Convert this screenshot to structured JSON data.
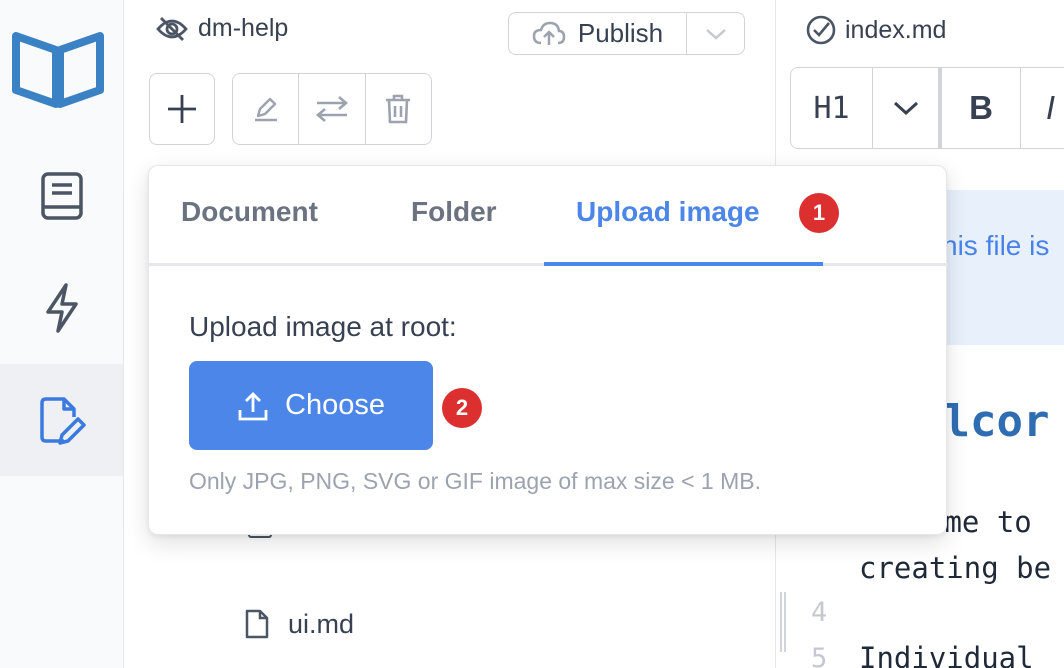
{
  "sidebar": {
    "items": [
      {
        "icon": "book-icon"
      },
      {
        "icon": "lightning-icon"
      },
      {
        "icon": "edit-file-icon",
        "active": true
      }
    ]
  },
  "files": {
    "repo_name": "dm-help",
    "publish_label": "Publish",
    "file_items": [
      "ui.md"
    ]
  },
  "popover": {
    "tabs": [
      "Document",
      "Folder",
      "Upload image"
    ],
    "active_tab": "Upload image",
    "badge_1": "1",
    "badge_2": "2",
    "upload_label": "Upload image at root:",
    "choose_label": "Choose",
    "hint": "Only JPG, PNG, SVG or GIF image of max size < 1 MB."
  },
  "editor": {
    "file_name": "index.md",
    "heading_select": "H1",
    "bold_label": "B",
    "italic_label": "I",
    "notice_text": "his file is",
    "heading_text": "elcor",
    "line1": "ome to",
    "line2": "creating be",
    "line_no_4": "4",
    "line_no_5": "5",
    "line5": "Individual"
  },
  "colors": {
    "accent": "#4b86e8",
    "badge": "#dc2f2f",
    "logo": "#3b82c4"
  }
}
